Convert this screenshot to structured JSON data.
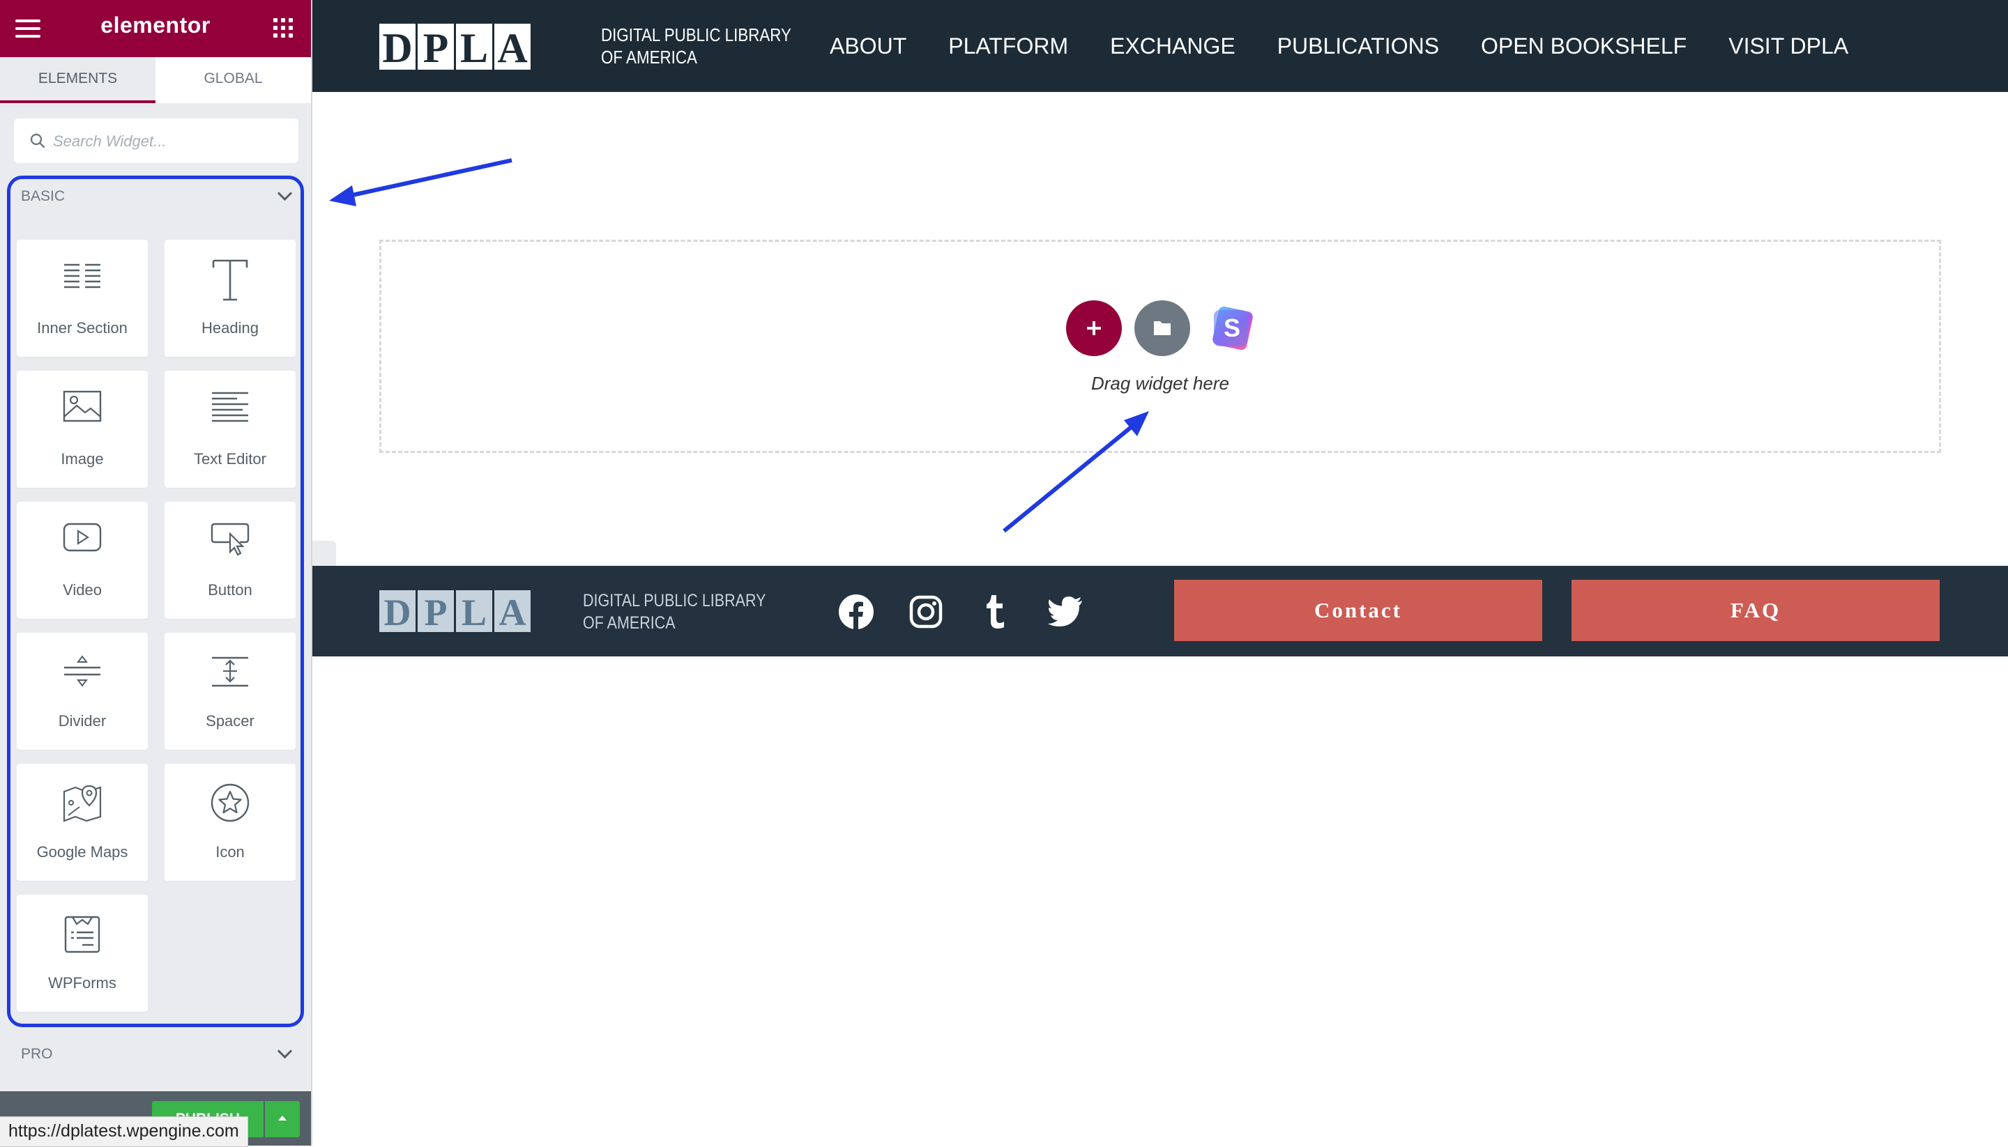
{
  "panel": {
    "brand": "elementor",
    "tabs": [
      {
        "label": "ELEMENTS"
      },
      {
        "label": "GLOBAL"
      }
    ],
    "search_placeholder": "Search Widget...",
    "categories": {
      "basic": "BASIC",
      "pro": "PRO"
    },
    "widgets": [
      {
        "label": "Inner Section",
        "icon": "inner-section-icon"
      },
      {
        "label": "Heading",
        "icon": "heading-icon"
      },
      {
        "label": "Image",
        "icon": "image-icon"
      },
      {
        "label": "Text Editor",
        "icon": "text-editor-icon"
      },
      {
        "label": "Video",
        "icon": "video-icon"
      },
      {
        "label": "Button",
        "icon": "button-icon"
      },
      {
        "label": "Divider",
        "icon": "divider-icon"
      },
      {
        "label": "Spacer",
        "icon": "spacer-icon"
      },
      {
        "label": "Google Maps",
        "icon": "google-maps-icon"
      },
      {
        "label": "Icon",
        "icon": "star-icon"
      },
      {
        "label": "WPForms",
        "icon": "wpforms-icon"
      }
    ],
    "publish_label": "PUBLISH",
    "status_url": "https://dplatest.wpengine.com"
  },
  "site": {
    "logo_letters": [
      "D",
      "P",
      "L",
      "A"
    ],
    "logo_caption_line1": "DIGITAL PUBLIC LIBRARY",
    "logo_caption_line2": "OF AMERICA",
    "nav": [
      "ABOUT",
      "PLATFORM",
      "EXCHANGE",
      "PUBLICATIONS",
      "OPEN BOOKSHELF",
      "VISIT DPLA"
    ],
    "drop_zone_text": "Drag widget here",
    "footer_buttons": {
      "contact": "Contact",
      "faq": "FAQ"
    },
    "social": [
      "facebook-icon",
      "instagram-icon",
      "tumblr-icon",
      "twitter-icon"
    ]
  },
  "colors": {
    "brand": "#93003a",
    "header_bg": "#1d2b36",
    "footer_bg": "#23323e",
    "footer_button": "#cd5c55",
    "annotation": "#1f3ae0",
    "publish": "#39b54a"
  }
}
